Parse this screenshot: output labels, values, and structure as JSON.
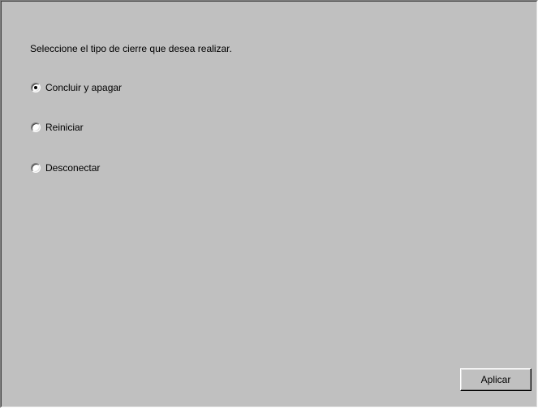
{
  "instruction": "Seleccione el tipo de cierre que desea realizar.",
  "options": [
    {
      "label": "Concluir y apagar",
      "selected": true
    },
    {
      "label": "Reiniciar",
      "selected": false
    },
    {
      "label": "Desconectar",
      "selected": false
    }
  ],
  "buttons": {
    "apply_label": "Aplicar"
  }
}
